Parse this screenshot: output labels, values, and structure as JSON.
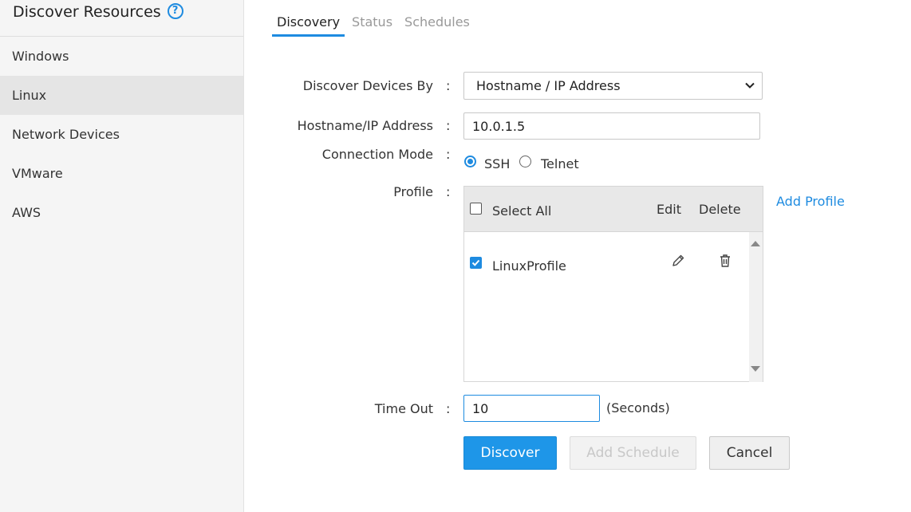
{
  "sidebar": {
    "title": "Discover Resources",
    "help_icon": "?",
    "items": [
      {
        "label": "Windows"
      },
      {
        "label": "Linux"
      },
      {
        "label": "Network Devices"
      },
      {
        "label": "VMware"
      },
      {
        "label": "AWS"
      }
    ],
    "active_item": "Linux"
  },
  "tabs": [
    {
      "label": "Discovery"
    },
    {
      "label": "Status"
    },
    {
      "label": "Schedules"
    }
  ],
  "active_tab": "Discovery",
  "form": {
    "colon": ":",
    "discover_by": {
      "label": "Discover Devices By",
      "value": "Hostname / IP Address"
    },
    "hostname": {
      "label": "Hostname/IP Address",
      "value": "10.0.1.5"
    },
    "connection_mode": {
      "label": "Connection Mode",
      "options": [
        {
          "label": "SSH",
          "selected": true
        },
        {
          "label": "Telnet",
          "selected": false
        }
      ]
    },
    "profile": {
      "label": "Profile",
      "header": {
        "select_all": "Select All",
        "edit": "Edit",
        "delete": "Delete"
      },
      "rows": [
        {
          "name": "LinuxProfile",
          "checked": true
        }
      ],
      "add_link": "Add Profile"
    },
    "timeout": {
      "label": "Time Out",
      "value": "10",
      "unit": "(Seconds)"
    }
  },
  "buttons": {
    "discover": "Discover",
    "add_schedule": "Add Schedule",
    "cancel": "Cancel"
  },
  "colors": {
    "accent": "#1e8be0",
    "primary_button": "#1e96e8",
    "sidebar_bg": "#f5f5f5",
    "sidebar_active": "#e5e5e5"
  },
  "icons": {
    "help": "question-circle-icon",
    "edit": "pencil-icon",
    "delete": "trash-icon",
    "select_chevron": "chevron-down-icon"
  }
}
